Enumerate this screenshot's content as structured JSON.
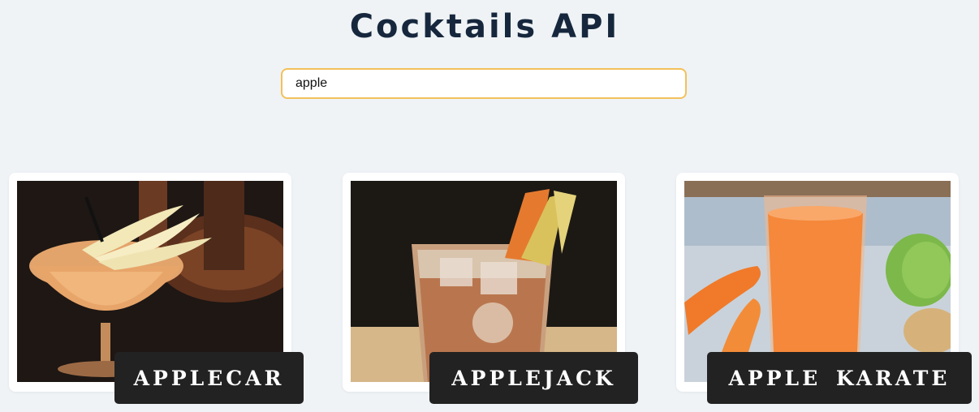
{
  "header": {
    "title": "Cocktails API"
  },
  "search": {
    "value": "apple"
  },
  "cocktails": [
    {
      "name": "APPLECAR",
      "image": "applecar-cocktail-photo"
    },
    {
      "name": "APPLEJACK",
      "image": "applejack-cocktail-photo"
    },
    {
      "name": "APPLE KARATE",
      "image": "apple-karate-cocktail-photo"
    }
  ],
  "colors": {
    "background": "#eff3f6",
    "title": "#16273d",
    "search_border": "#f2c15a",
    "label_bg": "#222222"
  }
}
